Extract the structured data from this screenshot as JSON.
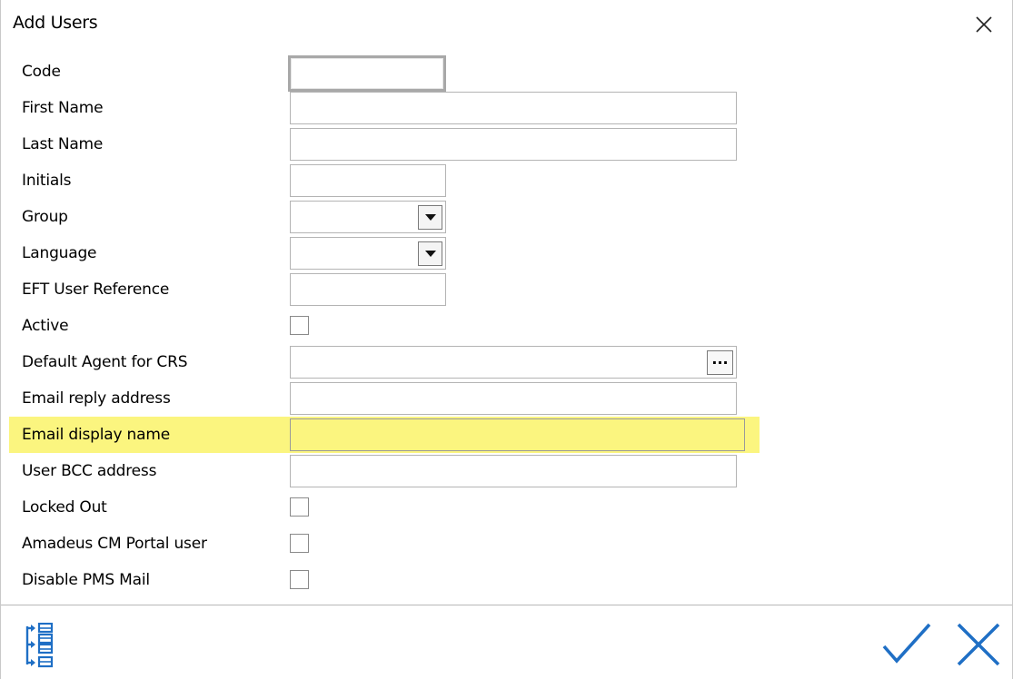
{
  "window": {
    "title": "Add Users"
  },
  "form": {
    "code": {
      "label": "Code",
      "value": ""
    },
    "first_name": {
      "label": "First Name",
      "value": ""
    },
    "last_name": {
      "label": "Last Name",
      "value": ""
    },
    "initials": {
      "label": "Initials",
      "value": ""
    },
    "group": {
      "label": "Group",
      "value": ""
    },
    "language": {
      "label": "Language",
      "value": ""
    },
    "eft_user_reference": {
      "label": "EFT User Reference",
      "value": ""
    },
    "active": {
      "label": "Active",
      "checked": false
    },
    "default_agent_for_crs": {
      "label": "Default Agent for CRS",
      "value": "",
      "lookup_label": "..."
    },
    "email_reply_address": {
      "label": "Email reply address",
      "value": ""
    },
    "email_display_name": {
      "label": "Email display name",
      "value": "",
      "highlight_color": "#fbf57f"
    },
    "user_bcc_address": {
      "label": "User BCC address",
      "value": ""
    },
    "locked_out": {
      "label": "Locked Out",
      "checked": false
    },
    "amadeus_cm_portal_user": {
      "label": "Amadeus CM Portal user",
      "checked": false
    },
    "disable_pms_mail": {
      "label": "Disable PMS Mail",
      "checked": false
    }
  },
  "footer": {
    "icons": [
      "tree-view-icon",
      "checkmark-icon",
      "close-icon"
    ],
    "accent_color": "#1f6fc5"
  }
}
